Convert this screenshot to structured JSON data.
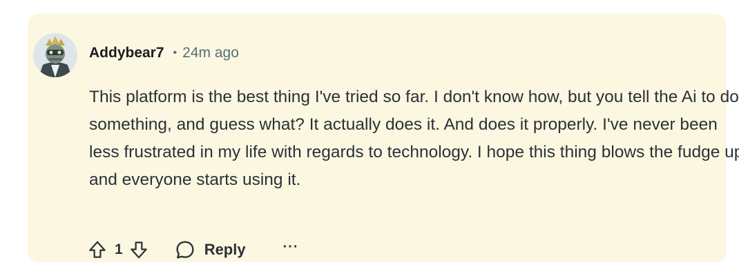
{
  "comment": {
    "author": "Addybear7",
    "separator": "•",
    "timestamp": "24m ago",
    "body": "This platform is the best thing I've tried so far. I don't know how, but you tell the Ai to do something, and guess what? It actually does it. And does it properly. I've never been less frustrated in my life with regards to technology. I hope this thing blows the fudge up and everyone starts using it."
  },
  "actions": {
    "upvote_icon": "arrow-up-outline-icon",
    "vote_count": "1",
    "downvote_icon": "arrow-down-outline-icon",
    "reply_icon": "speech-bubble-icon",
    "reply_label": "Reply",
    "more_label": "···"
  },
  "colors": {
    "card_background": "#fcf7e1",
    "text_primary": "#1c1c1c",
    "text_secondary": "#576f76"
  }
}
